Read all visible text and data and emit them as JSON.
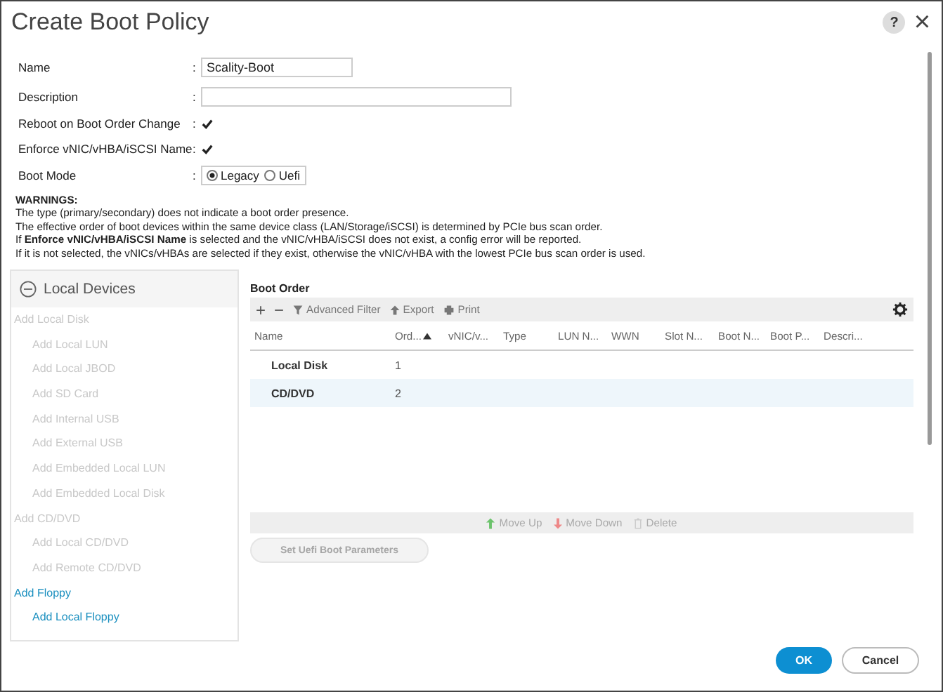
{
  "window": {
    "title": "Create Boot Policy",
    "help": "?",
    "close": "×"
  },
  "form": [
    {
      "kind": "text",
      "label": "Name",
      "separator": ":",
      "value": "Scality-Boot"
    },
    {
      "kind": "textwide",
      "label": "Description",
      "separator": ":"
    },
    {
      "kind": "check",
      "label": "Reboot on Boot Order Change",
      "separator": ":",
      "checked": true
    },
    {
      "kind": "check",
      "label": "Enforce vNIC/vHBA/iSCSI Name",
      "separator": ":",
      "checked": true
    },
    {
      "kind": "radio",
      "label": "Boot Mode",
      "separator": ":",
      "options": [
        {
          "label": "Legacy",
          "selected": true
        },
        {
          "label": "Uefi",
          "selected": false
        }
      ]
    }
  ],
  "warnings": {
    "title": "WARNINGS:",
    "lines": [
      "The type (primary/secondary) does not indicate a boot order presence.",
      "The effective order of boot devices within the same device class (LAN/Storage/iSCSI) is determined by PCIe bus scan order.",
      "If **Enforce vNIC/vHBA/iSCSI Name** is selected and the vNIC/vHBA/iSCSI does not exist, a config error will be reported.",
      "If it is not selected, the vNICs/vHBAs are selected if they exist, otherwise the vNIC/vHBA with the lowest PCIe bus scan order is used."
    ]
  },
  "sidebar": {
    "title": "Local Devices",
    "expanded": true,
    "items": [
      {
        "label": "Add Local Disk",
        "disabled": true,
        "children": [
          {
            "label": "Add Local LUN",
            "disabled": true
          },
          {
            "label": "Add Local JBOD",
            "disabled": true
          },
          {
            "label": "Add SD Card",
            "disabled": true
          },
          {
            "label": "Add Internal USB",
            "disabled": true
          },
          {
            "label": "Add External USB",
            "disabled": true
          },
          {
            "label": "Add Embedded Local LUN",
            "disabled": true
          },
          {
            "label": "Add Embedded Local Disk",
            "disabled": true
          }
        ]
      },
      {
        "label": "Add CD/DVD",
        "disabled": true,
        "children": [
          {
            "label": "Add Local CD/DVD",
            "disabled": true
          },
          {
            "label": "Add Remote CD/DVD",
            "disabled": true
          }
        ]
      },
      {
        "label": "Add Floppy",
        "disabled": false,
        "children": [
          {
            "label": "Add Local Floppy",
            "disabled": false
          }
        ]
      }
    ]
  },
  "boot_order": {
    "title": "Boot Order",
    "toolbar": [
      {
        "kind": "add",
        "label": "+"
      },
      {
        "kind": "remove",
        "label": "−"
      },
      {
        "kind": "filter",
        "label": "Advanced Filter"
      },
      {
        "kind": "export",
        "label": "Export"
      },
      {
        "kind": "print",
        "label": "Print"
      }
    ],
    "columns": [
      {
        "label": "Name",
        "sorted": false
      },
      {
        "label": "Ord...",
        "sorted": true
      },
      {
        "label": "vNIC/v...",
        "sorted": false
      },
      {
        "label": "Type",
        "sorted": false
      },
      {
        "label": "LUN N...",
        "sorted": false
      },
      {
        "label": "WWN",
        "sorted": false
      },
      {
        "label": "Slot N...",
        "sorted": false
      },
      {
        "label": "Boot N...",
        "sorted": false
      },
      {
        "label": "Boot P...",
        "sorted": false
      },
      {
        "label": "Descri...",
        "sorted": false
      }
    ],
    "rows": [
      {
        "name": "Local Disk",
        "order": "1",
        "selected": false
      },
      {
        "name": "CD/DVD",
        "order": "2",
        "selected": true
      }
    ],
    "actions": [
      {
        "kind": "up",
        "label": "Move Up",
        "disabled": true
      },
      {
        "kind": "down",
        "label": "Move Down",
        "disabled": true
      },
      {
        "kind": "delete",
        "label": "Delete",
        "disabled": true
      }
    ],
    "uefi_button": {
      "label": "Set Uefi Boot Parameters",
      "disabled": true
    }
  },
  "buttons": [
    {
      "kind": "primary",
      "label": "OK"
    },
    {
      "kind": "secondary",
      "label": "Cancel"
    }
  ]
}
